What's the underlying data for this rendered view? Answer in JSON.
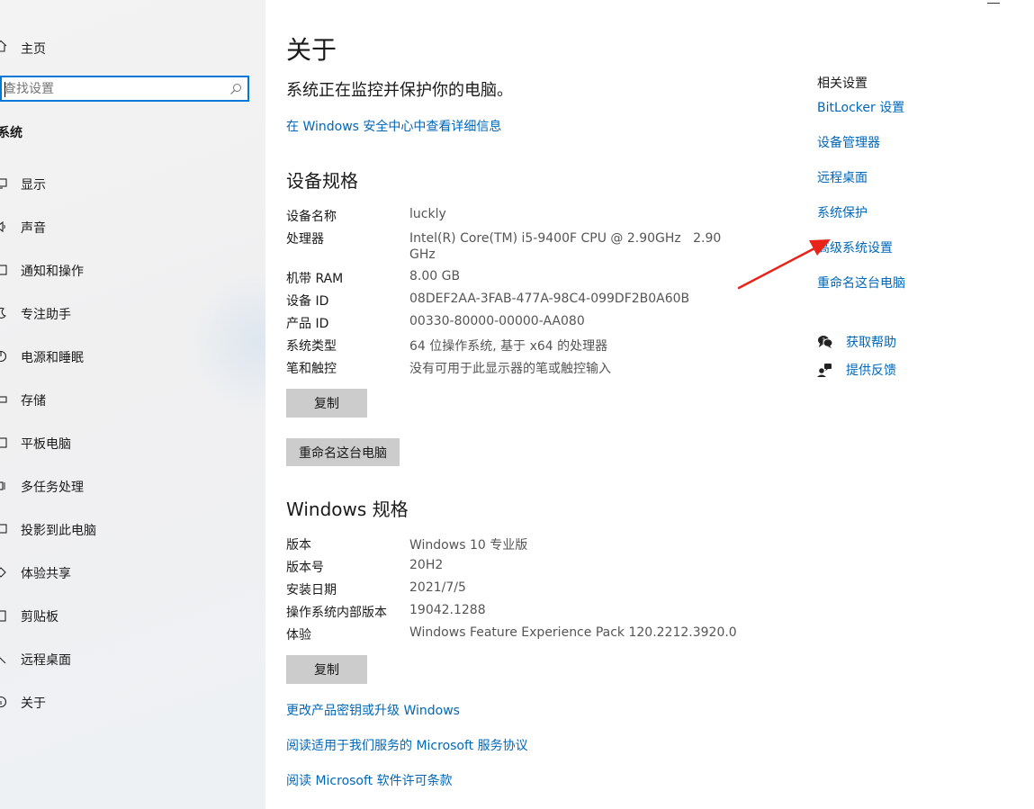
{
  "sidebar": {
    "home_label": "主页",
    "search_placeholder": "查找设置",
    "section_title": "系统",
    "items": [
      {
        "label": "显示",
        "icon": "display-icon"
      },
      {
        "label": "声音",
        "icon": "sound-icon"
      },
      {
        "label": "通知和操作",
        "icon": "notification-icon"
      },
      {
        "label": "专注助手",
        "icon": "focus-assist-icon"
      },
      {
        "label": "电源和睡眠",
        "icon": "power-icon"
      },
      {
        "label": "存储",
        "icon": "storage-icon"
      },
      {
        "label": "平板电脑",
        "icon": "tablet-icon"
      },
      {
        "label": "多任务处理",
        "icon": "multitasking-icon"
      },
      {
        "label": "投影到此电脑",
        "icon": "projecting-icon"
      },
      {
        "label": "体验共享",
        "icon": "shared-experiences-icon"
      },
      {
        "label": "剪贴板",
        "icon": "clipboard-icon"
      },
      {
        "label": "远程桌面",
        "icon": "remote-desktop-icon"
      },
      {
        "label": "关于",
        "icon": "info-icon"
      }
    ]
  },
  "main": {
    "title": "关于",
    "protection_text": "系统正在监控并保护你的电脑。",
    "security_link": "在 Windows 安全中心中查看详细信息",
    "device_specs": {
      "heading": "设备规格",
      "rows": [
        {
          "label": "设备名称",
          "value": "luckly"
        },
        {
          "label": "处理器",
          "value": "Intel(R) Core(TM) i5-9400F CPU @ 2.90GHz   2.90",
          "value2": "GHz"
        },
        {
          "label": "机带 RAM",
          "value": "8.00 GB"
        },
        {
          "label": "设备 ID",
          "value": "08DEF2AA-3FAB-477A-98C4-099DF2B0A60B"
        },
        {
          "label": "产品 ID",
          "value": "00330-80000-00000-AA080"
        },
        {
          "label": "系统类型",
          "value": "64 位操作系统, 基于 x64 的处理器"
        },
        {
          "label": "笔和触控",
          "value": "没有可用于此显示器的笔或触控输入"
        }
      ],
      "copy_label": "复制",
      "rename_label": "重命名这台电脑"
    },
    "windows_specs": {
      "heading": "Windows 规格",
      "rows": [
        {
          "label": "版本",
          "value": "Windows 10 专业版"
        },
        {
          "label": "版本号",
          "value": "20H2"
        },
        {
          "label": "安装日期",
          "value": "2021/7/5"
        },
        {
          "label": "操作系统内部版本",
          "value": "19042.1288"
        },
        {
          "label": "体验",
          "value": "Windows Feature Experience Pack 120.2212.3920.0"
        }
      ],
      "copy_label": "复制"
    },
    "footer_links": [
      "更改产品密钥或升级 Windows",
      "阅读适用于我们服务的 Microsoft 服务协议",
      "阅读 Microsoft 软件许可条款"
    ]
  },
  "related": {
    "title": "相关设置",
    "links": [
      "BitLocker 设置",
      "设备管理器",
      "远程桌面",
      "系统保护",
      "高级系统设置",
      "重命名这台电脑"
    ],
    "help": [
      {
        "label": "获取帮助",
        "icon": "get-help-icon"
      },
      {
        "label": "提供反馈",
        "icon": "feedback-icon"
      }
    ]
  },
  "colors": {
    "accent": "#0067b8",
    "search_border": "#0078d7",
    "button_bg": "#cccccc",
    "annotation_arrow": "#e8231a"
  }
}
